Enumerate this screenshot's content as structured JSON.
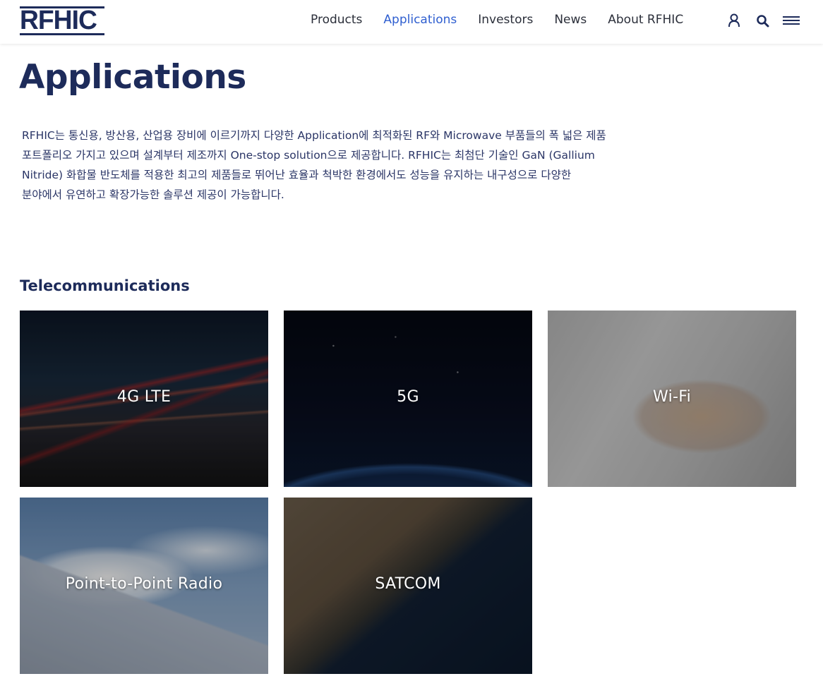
{
  "brand": {
    "logo_text": "RFHIC",
    "color_primary": "#1d2b5a",
    "color_accent": "#2f5fd0"
  },
  "nav": {
    "items": [
      {
        "label": "Products",
        "active": false
      },
      {
        "label": "Applications",
        "active": true
      },
      {
        "label": "Investors",
        "active": false
      },
      {
        "label": "News",
        "active": false
      },
      {
        "label": "About RFHIC",
        "active": false
      }
    ],
    "icons": [
      "user-icon",
      "search-icon",
      "menu-icon"
    ]
  },
  "page": {
    "title": "Applications",
    "intro_lines": [
      "RFHIC는 통신용, 방산용, 산업용 장비에 이르기까지 다양한 Application에 최적화된 RF와 Microwave 부품들의 폭 넓은 제품",
      "포트폴리오 가지고 있으며 설계부터 제조까지 One-stop solution으로 제공합니다. RFHIC는 최첨단 기술인 GaN (Gallium",
      "Nitride) 화합물 반도체를 적용한 최고의 제품들로 뛰어난 효율과 척박한 환경에서도 성능을 유지하는 내구성으로 다양한",
      "분야에서 유연하고 확장가능한 솔루션 제공이 가능합니다."
    ]
  },
  "section": {
    "title": "Telecommunications",
    "tiles": [
      {
        "label": "4G LTE"
      },
      {
        "label": "5G"
      },
      {
        "label": "Wi-Fi"
      },
      {
        "label": "Point-to-Point Radio"
      },
      {
        "label": "SATCOM"
      }
    ]
  }
}
